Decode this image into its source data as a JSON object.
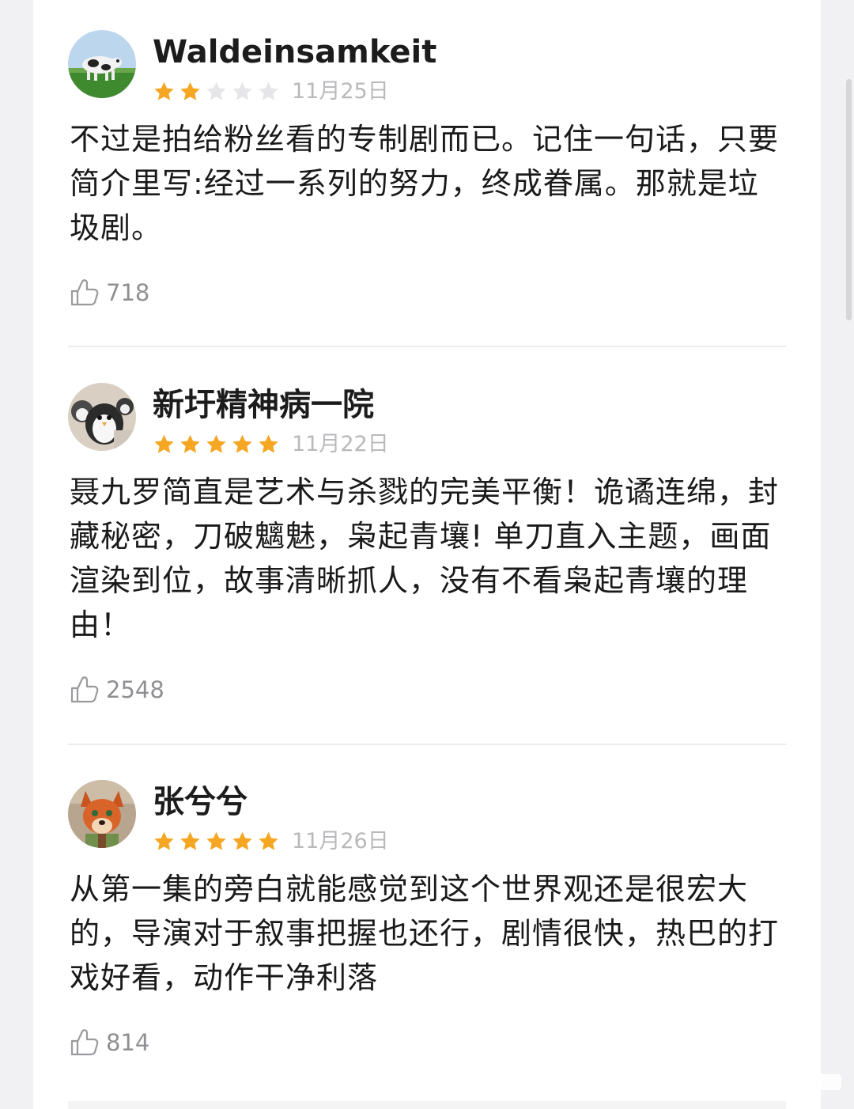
{
  "reviews": [
    {
      "username": "Waldeinsamkeit",
      "date": "11月25日",
      "rating": 2,
      "max_rating": 5,
      "content": "不过是拍给粉丝看的专制剧而已。记住一句话，只要简介里写:经过一系列的努力，终成眷属。那就是垃圾剧。",
      "likes": "718",
      "avatar": "cow-field-avatar"
    },
    {
      "username": "新圩精神病一院",
      "date": "11月22日",
      "rating": 5,
      "max_rating": 5,
      "content": "聂九罗简直是艺术与杀戮的完美平衡！诡谲连绵，封藏秘密，刀破魑魅，枭起青壤! 单刀直入主题，画面渲染到位，故事清晰抓人，没有不看枭起青壤的理由！",
      "likes": "2548",
      "avatar": "penguin-plush-avatar"
    },
    {
      "username": "张兮兮",
      "date": "11月26日",
      "rating": 5,
      "max_rating": 5,
      "content": "从第一集的旁白就能感觉到这个世界观还是很宏大的，导演对于叙事把握也还行，剧情很快，热巴的打戏好看，动作干净利落",
      "likes": "814",
      "avatar": "fox-cartoon-avatar"
    }
  ],
  "colors": {
    "star_filled": "#f5a623",
    "star_empty": "#e6e6e8",
    "date": "#b9b9bd",
    "like_count": "#8f8f94"
  }
}
